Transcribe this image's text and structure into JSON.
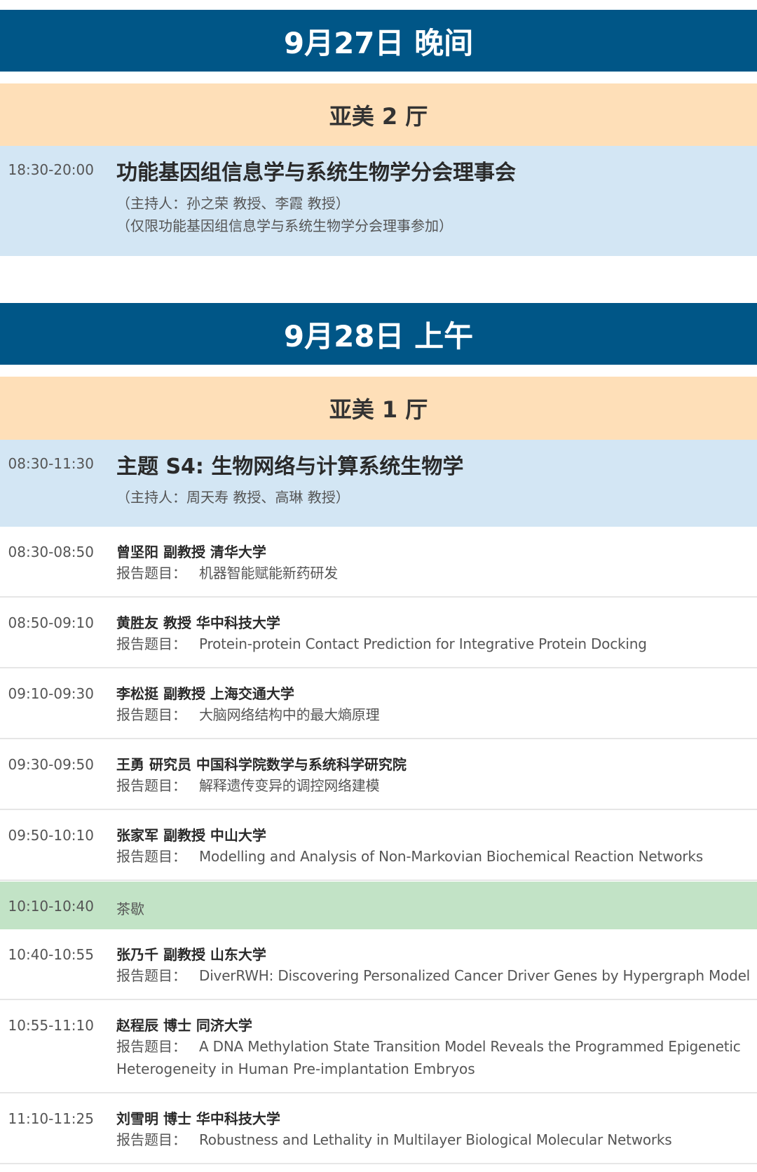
{
  "days": [
    {
      "title": "9月27日 晚间",
      "hall": "亚美 2 厅",
      "session": {
        "time": "18:30-20:00",
        "title": "功能基因组信息学与系统生物学分会理事会",
        "notes": [
          "（主持人：孙之荣 教授、李霞 教授）",
          "（仅限功能基因组信息学与系统生物学分会理事参加）"
        ]
      }
    },
    {
      "title": "9月28日 上午",
      "hall": "亚美 1 厅",
      "session": {
        "time": "08:30-11:30",
        "title": "主题 S4: 生物网络与计算系统生物学",
        "notes": [
          "（主持人：周天寿 教授、高琳 教授）"
        ]
      }
    }
  ],
  "talk_label": "报告题目：",
  "talks": [
    {
      "time": "08:30-08:50",
      "speaker": "曾坚阳 副教授 清华大学",
      "title": "机器智能赋能新药研发"
    },
    {
      "time": "08:50-09:10",
      "speaker": "黄胜友 教授 华中科技大学",
      "title": "Protein-protein Contact Prediction for Integrative Protein Docking"
    },
    {
      "time": "09:10-09:30",
      "speaker": "李松挺 副教授 上海交通大学",
      "title": "大脑网络结构中的最大熵原理"
    },
    {
      "time": "09:30-09:50",
      "speaker": "王勇 研究员 中国科学院数学与系统科学研究院",
      "title": "解释遗传变异的调控网络建模"
    },
    {
      "time": "09:50-10:10",
      "speaker": "张家军 副教授 中山大学",
      "title": "Modelling and Analysis of Non-Markovian Biochemical Reaction Networks"
    },
    {
      "time": "10:40-10:55",
      "speaker": "张乃千 副教授 山东大学",
      "title": "DiverRWH: Discovering Personalized Cancer Driver Genes by Hypergraph Model"
    },
    {
      "time": "10:55-11:10",
      "speaker": "赵程辰 博士 同济大学",
      "title": "A DNA Methylation State Transition Model Reveals the Programmed Epigenetic",
      "title_cont": "Heterogeneity in Human Pre-implantation Embryos"
    },
    {
      "time": "11:10-11:25",
      "speaker": "刘雪明 博士 华中科技大学",
      "title": "Robustness and Lethality in Multilayer Biological Molecular Networks"
    }
  ],
  "break": {
    "time": "10:10-10:40",
    "label": "茶歇"
  },
  "colors": {
    "day_header": "#005687",
    "hall_header": "#fedfb8",
    "session_row": "#d3e6f4",
    "break_row": "#c2e3c6"
  }
}
